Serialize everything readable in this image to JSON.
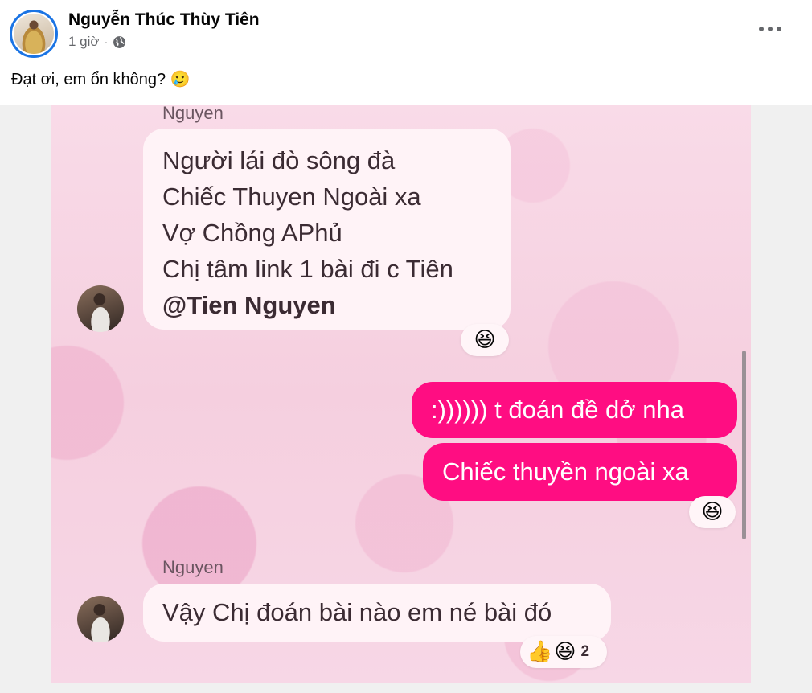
{
  "post": {
    "author_name": "Nguyễn Thúc Thùy Tiên",
    "time": "1 giờ",
    "separator": "·",
    "privacy_icon": "globe-icon",
    "more_icon": "more-options-icon",
    "text": "Đạt ơi, em ổn không? 🥲"
  },
  "chat": {
    "messages": [
      {
        "sender": "Nguyen",
        "lines": [
          "Người lái đò sông đà",
          "Chiếc Thuyen Ngoài xa",
          "Vợ Chồng APhủ",
          "Chị tâm link 1 bài đi c Tiên"
        ],
        "mention": "@Tien Nguyen",
        "reaction": "😆"
      },
      {
        "outgoing": [
          ":)))))) t đoán đề dở nha",
          "Chiếc thuyền ngoài xa"
        ],
        "reaction": "😆"
      },
      {
        "sender": "Nguyen",
        "text": "Vậy Chị đoán bài nào em né bài đó",
        "reactions": [
          "👍",
          "😆"
        ],
        "reaction_count": "2"
      }
    ]
  },
  "colors": {
    "outgoing_bubble": "#ff0d82",
    "incoming_bubble": "#fff3f7",
    "background": "#f7d3e3",
    "story_ring": "#1b74e4"
  }
}
